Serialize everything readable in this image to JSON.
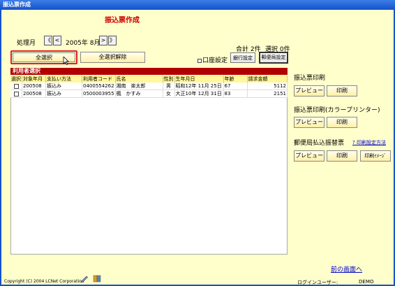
{
  "window": {
    "title": "振込票作成"
  },
  "page_title": "振込票作成",
  "period": {
    "label": "処理月",
    "first_label": "《",
    "prev_label": "<",
    "value": "2005年 8月",
    "next_label": ">",
    "last_label": "》"
  },
  "summary": {
    "total": "合計 2件",
    "selected": "選択 0件"
  },
  "toolbar": {
    "select_all": "全選択",
    "deselect_all": "全選択解除",
    "account_setting": "口座設定",
    "bank_setting": "銀行設定",
    "post_setting": "郵便局設定"
  },
  "user_table": {
    "title": "利用者選択",
    "columns": [
      "選択",
      "対象年月",
      "支払い方法",
      "利用者コード",
      "氏名",
      "性別",
      "生年月日",
      "年齢",
      "請求金額"
    ],
    "rows": [
      {
        "target_month": "200508",
        "method": "振込み",
        "code": "0400554262",
        "name": "湘南　楽太郎",
        "sex": "男",
        "birth": "昭和12年 11月 25日",
        "age": "67",
        "amount": "5112"
      },
      {
        "target_month": "200508",
        "method": "振込み",
        "code": "0500003955",
        "name": "楓　かすみ",
        "sex": "女",
        "birth": "大正10年 12月 31日",
        "age": "83",
        "amount": "2151"
      }
    ]
  },
  "print_sections": {
    "transfer": {
      "title": "振込票印刷",
      "preview": "プレビュー",
      "print": "印刷"
    },
    "transfer_color": {
      "title": "振込票印刷(カラープリンター)",
      "preview": "プレビュー",
      "print": "印刷"
    },
    "postal": {
      "title": "郵便局払込振替票",
      "help_link": "? 印刷設定方法",
      "preview": "プレビュー",
      "print": "印刷",
      "print_image": "印刷ｲﾒｰｼﾞ"
    }
  },
  "back_link": "前の画面へ",
  "footer": {
    "copyright": "Copyright (C) 2004 LCNet Corporation",
    "login_label": "ログインユーザー:",
    "login_user": "DEMO"
  },
  "colors": {
    "title_bar": "#1552c9",
    "background": "#ffffcc",
    "accent_red": "#b00000",
    "selection_border": "#e02020"
  }
}
